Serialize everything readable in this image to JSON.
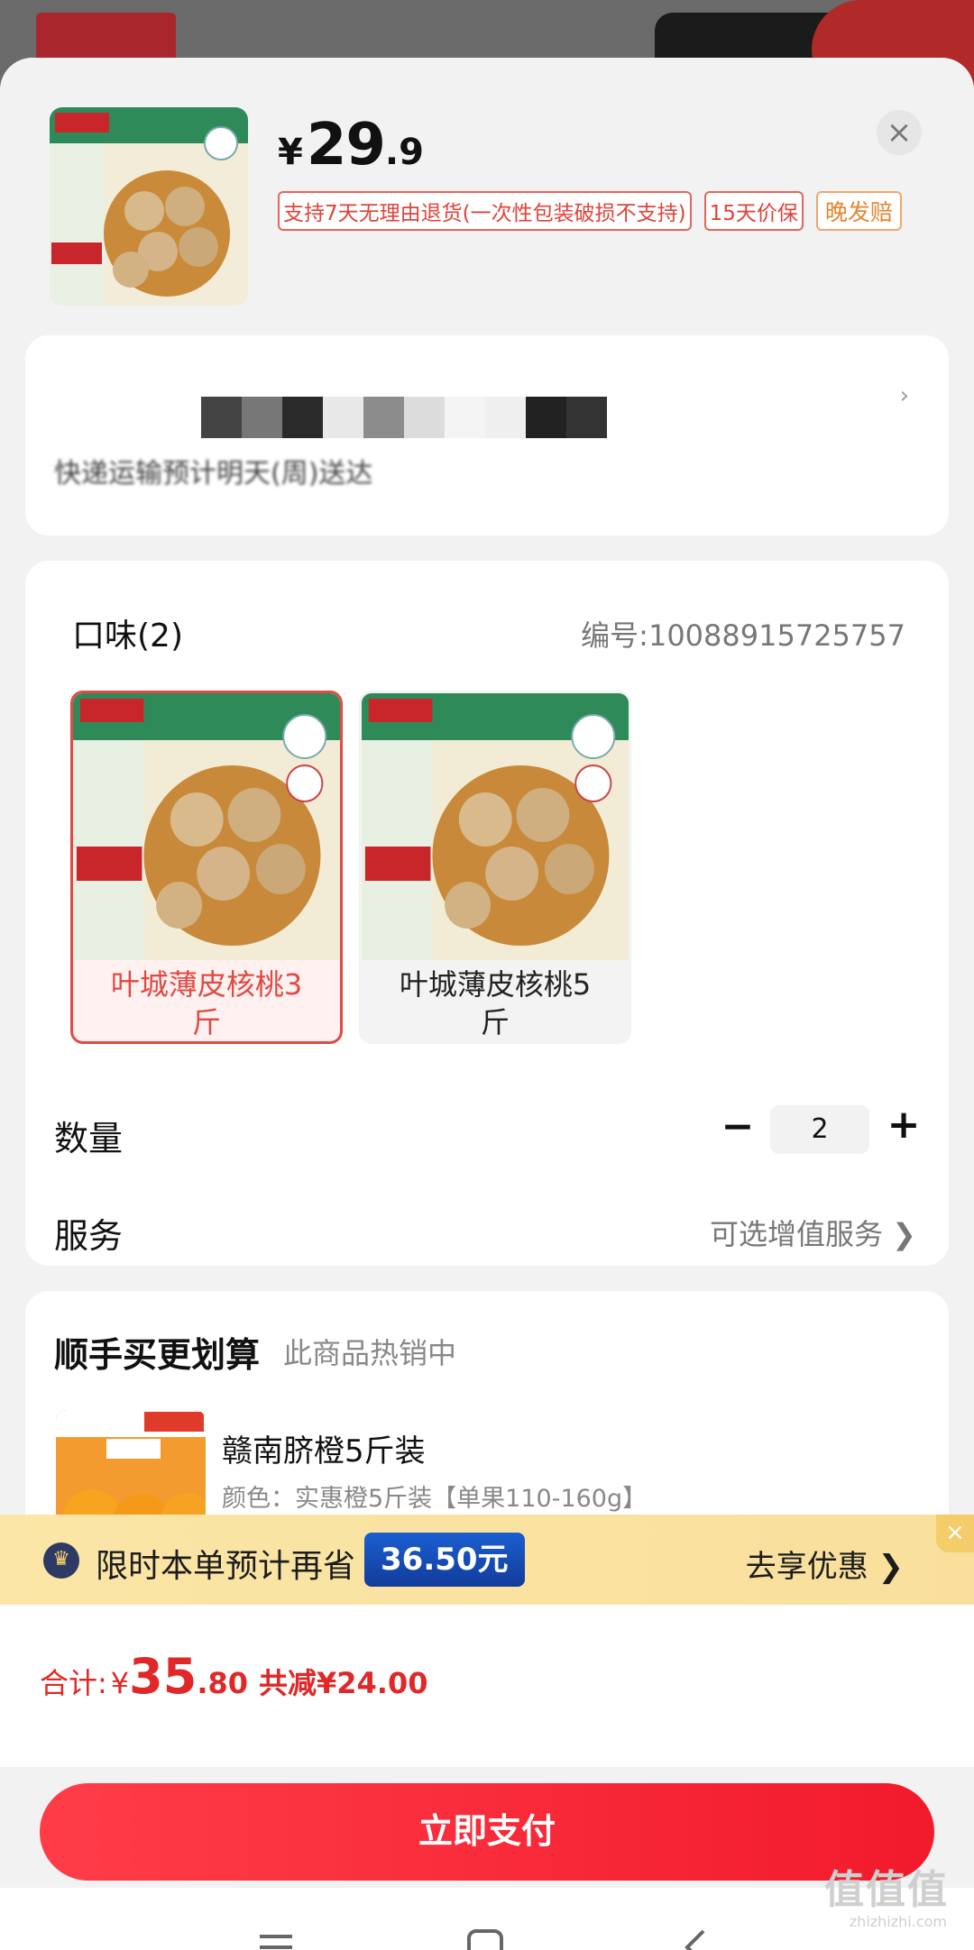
{
  "product": {
    "price_currency": "¥",
    "price_integer": "29",
    "price_decimal": ".9",
    "tags": [
      "支持7天无理由退货(一次性包装破损不支持)",
      "15天价保",
      "晚发赔"
    ]
  },
  "address": {
    "faint_line": "快递运输预计明天(周)送达"
  },
  "spec": {
    "title": "口味(2)",
    "sku": "编号:10088915725757",
    "variants": [
      {
        "label": "叶城薄皮核桃3斤",
        "selected": true
      },
      {
        "label": "叶城薄皮核桃5斤",
        "selected": false
      }
    ],
    "quantity_label": "数量",
    "quantity_value": "2",
    "service_label": "服务",
    "service_value": "可选增值服务 ❯"
  },
  "cross_sell": {
    "title": "顺手买更划算",
    "subtitle": "此商品热销中",
    "item_name": "赣南脐橙5斤装",
    "item_attr": "颜色：实惠橙5斤装【单果110-160g】"
  },
  "promo": {
    "text": "限时本单预计再省",
    "amount": "36.50元",
    "cta": "去享优惠 ❯",
    "close": "×"
  },
  "total": {
    "label": "合计:",
    "currency": "¥",
    "integer": "35",
    "decimal": ".80",
    "saving": "共减¥24.00"
  },
  "pay_button": "立即支付",
  "watermark": "值值值",
  "watermark_sub": "zhizhizhi.com",
  "colors": {
    "accent": "#f21a2b",
    "price_red": "#e02828",
    "promo_blue": "#1a5fd0",
    "promo_bg": "#fbe6a7"
  }
}
